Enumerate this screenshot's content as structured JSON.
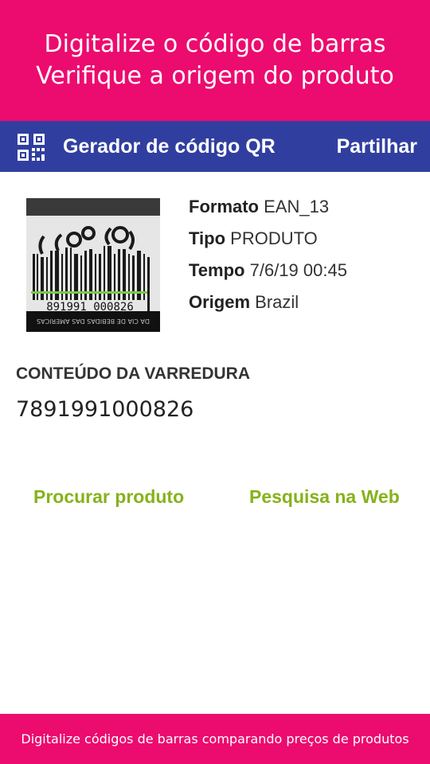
{
  "banner": {
    "line1": "Digitalize o código de barras",
    "line2": "Verifique a origem do produto"
  },
  "toolbar": {
    "icon": "qr-code-icon",
    "title": "Gerador de código QR",
    "share_label": "Partilhar",
    "color": "#303f9f"
  },
  "thumbnail": {
    "printed_number": "891991 000826",
    "fine_print": "DA CIA DE BEBIDAS DAS AMERICAS"
  },
  "details": {
    "format_label": "Formato",
    "format_value": "EAN_13",
    "type_label": "Tipo",
    "type_value": "PRODUTO",
    "time_label": "Tempo",
    "time_value": "7/6/19 00:45",
    "origin_label": "Origem",
    "origin_value": "Brazil"
  },
  "scan": {
    "section_label": "CONTEÚDO DA VARREDURA",
    "value": "7891991000826"
  },
  "actions": {
    "search_product": "Procurar produto",
    "web_search": "Pesquisa na Web",
    "color": "#86b21a"
  },
  "footer": {
    "text": "Digitalize códigos de barras comparando preços de produtos"
  },
  "colors": {
    "accent": "#ec0b6f"
  }
}
